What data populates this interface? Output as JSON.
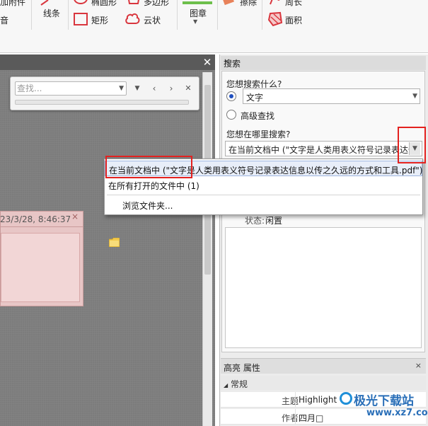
{
  "ribbon": {
    "attach_label": "加附件",
    "line_label": "线条",
    "ellipse_label": "椭圆形",
    "polygon_label": "多边形",
    "audio_label": "音",
    "rect_label": "矩形",
    "cloud_label": "云状",
    "stamp_label": "图章",
    "erase_label": "擦除",
    "perimeter_label": "周长",
    "area_label": "面积"
  },
  "findbar": {
    "placeholder": "查找..."
  },
  "note": {
    "date": "23/3/28, 8:46:37",
    "close": "×"
  },
  "search_panel": {
    "title": "搜索",
    "close": "×",
    "question_what": "您想搜索什么?",
    "what_value": "文字",
    "advanced_label": "高级查找",
    "question_where": "您想在哪里搜索?",
    "where_value": "在当前文档中 (\"文字是人类用表义符号记录表达信息以传之久远的方式和工具.pdf\")",
    "status_label": "状态:",
    "status_value": "闲置"
  },
  "dropdown": {
    "items": [
      "在当前文档中 (\"文字是人类用表义符号记录表达信息以传之久远的方式和工具.pdf\")",
      "在所有打开的文件中 (1)",
      "浏览文件夹..."
    ]
  },
  "props": {
    "title": "高亮 属性",
    "close": "×",
    "category": "常规",
    "rows": [
      {
        "key": "主题",
        "value": "Highlight"
      },
      {
        "key": "作者",
        "value": "四月□"
      }
    ]
  },
  "watermark": {
    "line1": "极光下载站",
    "line2": "www.xz7.com"
  },
  "colors": {
    "accent_blue": "#1f4fbf",
    "annotation_red": "#e3211f",
    "note_pink": "#e8c6c6"
  }
}
